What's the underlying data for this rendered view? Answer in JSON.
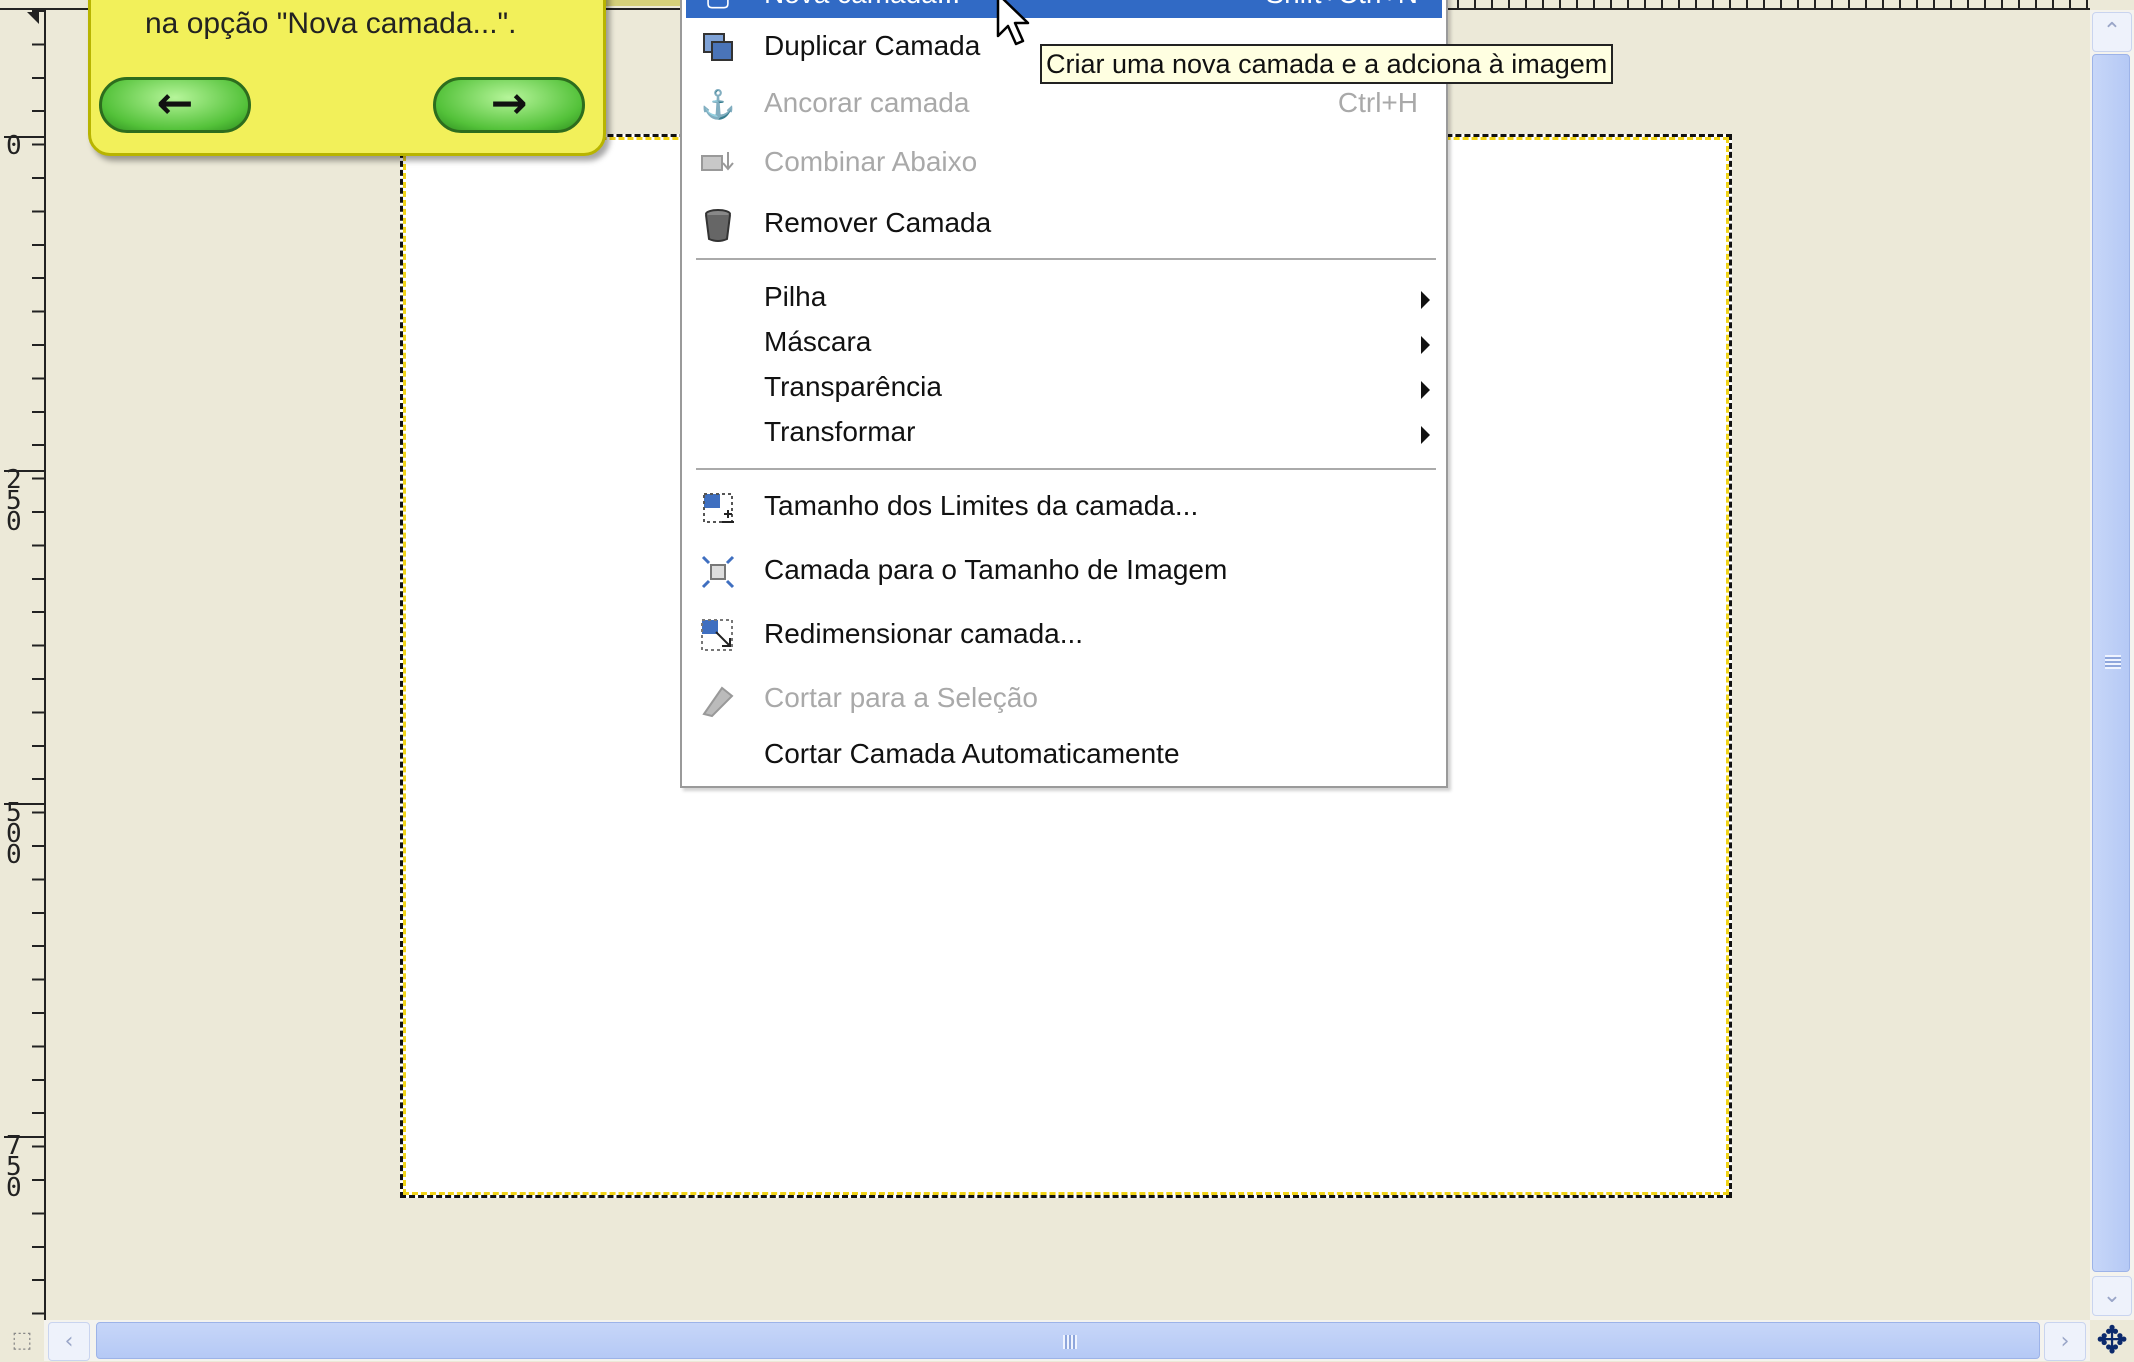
{
  "ruler": {
    "left_numbers": [
      "0",
      "2\n5\n0",
      "5\n0\n0",
      "7\n5\n0"
    ]
  },
  "balloon": {
    "text": "na opção \"Nova camada...\".",
    "prev_icon": "arrow-left-icon",
    "next_icon": "arrow-right-icon",
    "color": "#f2f05a"
  },
  "menu": {
    "active_color": "#316ac5",
    "items": [
      {
        "label": "Nova camada...",
        "accel": "Shift+Ctrl+N",
        "icon": "new-layer-icon",
        "state": "active"
      },
      {
        "label": "Duplicar Camada",
        "accel": "",
        "icon": "duplicate-layer-icon",
        "state": "normal"
      },
      {
        "label": "Ancorar camada",
        "accel": "Ctrl+H",
        "icon": "anchor-icon",
        "state": "disabled"
      },
      {
        "label": "Combinar Abaixo",
        "accel": "",
        "icon": "merge-down-icon",
        "state": "disabled"
      },
      {
        "label": "Remover Camada",
        "accel": "",
        "icon": "trash-icon",
        "state": "normal"
      },
      {
        "label": "Pilha",
        "accel": "",
        "icon": "",
        "state": "submenu"
      },
      {
        "label": "Máscara",
        "accel": "",
        "icon": "",
        "state": "submenu"
      },
      {
        "label": "Transparência",
        "accel": "",
        "icon": "",
        "state": "submenu"
      },
      {
        "label": "Transformar",
        "accel": "",
        "icon": "",
        "state": "submenu"
      },
      {
        "label": "Tamanho dos Limites da camada...",
        "accel": "",
        "icon": "layer-boundary-icon",
        "state": "normal"
      },
      {
        "label": "Camada para o Tamanho de Imagem",
        "accel": "",
        "icon": "layer-to-image-size-icon",
        "state": "normal"
      },
      {
        "label": "Redimensionar camada...",
        "accel": "",
        "icon": "scale-layer-icon",
        "state": "normal"
      },
      {
        "label": "Cortar para a Seleção",
        "accel": "",
        "icon": "crop-icon",
        "state": "disabled"
      },
      {
        "label": "Cortar Camada Automaticamente",
        "accel": "",
        "icon": "",
        "state": "normal"
      }
    ]
  },
  "tooltip": {
    "text": "Criar uma nova camada e a adciona à imagem"
  },
  "scroll": {
    "up_icon": "scroll-up-icon",
    "down_icon": "scroll-down-icon",
    "left_icon": "scroll-left-icon",
    "right_icon": "scroll-right-icon",
    "navigate_icon": "navigate-icon",
    "quickmask_icon": "quick-mask-icon"
  }
}
